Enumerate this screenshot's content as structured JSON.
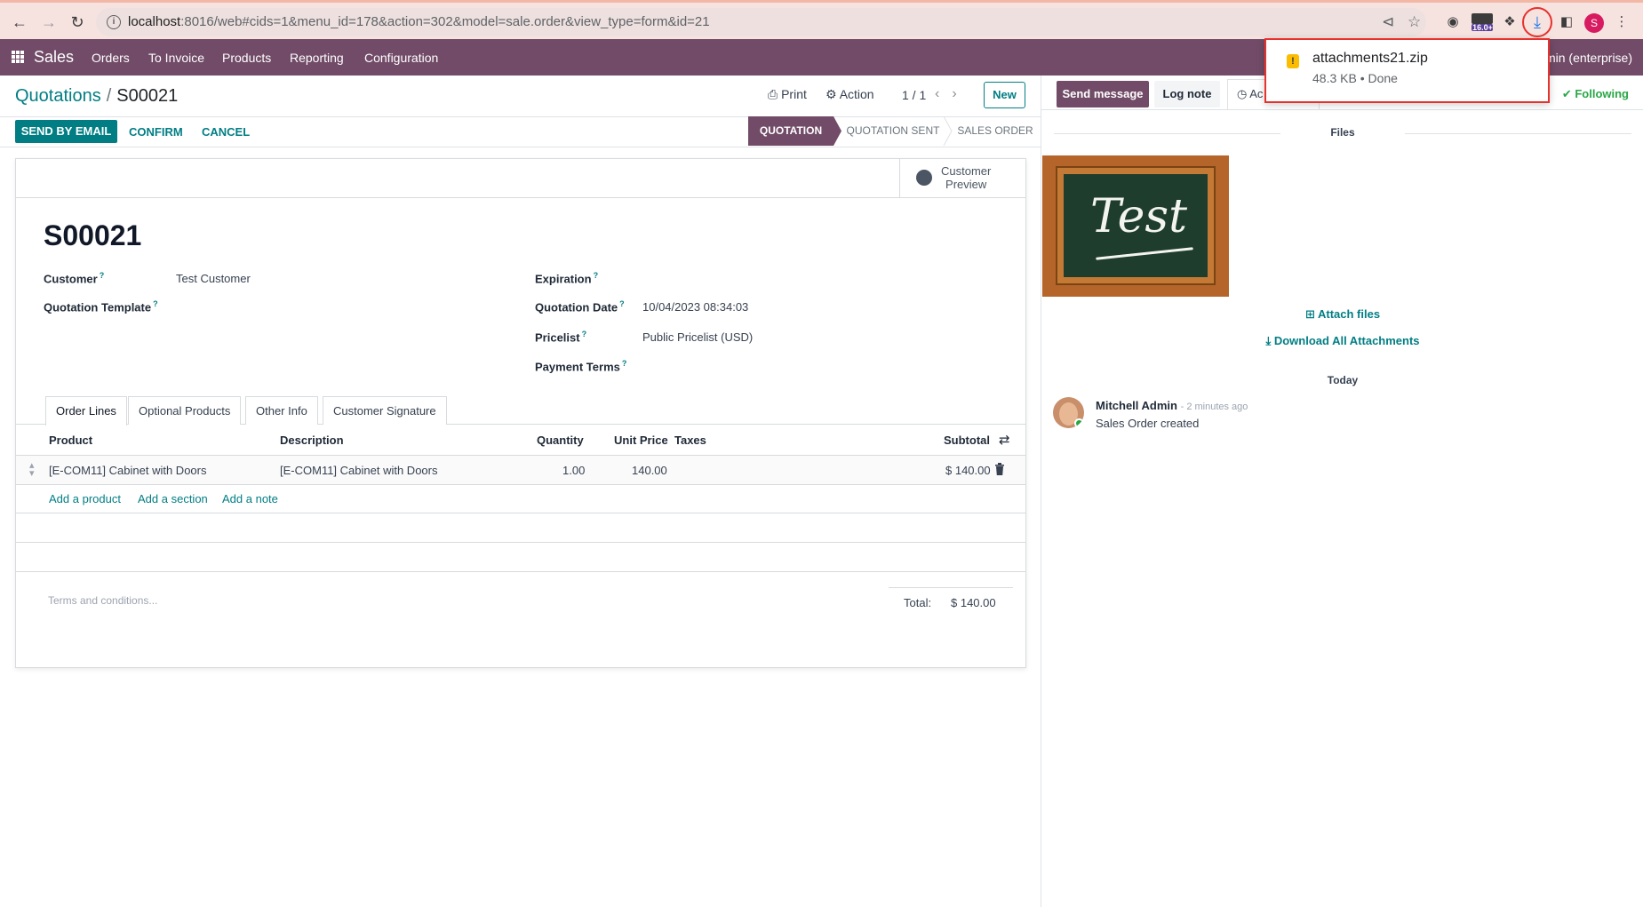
{
  "browser": {
    "url_host": "localhost",
    "url_rest": ":8016/web#cids=1&menu_id=178&action=302&model=sale.order&view_type=form&id=21",
    "ext_badge": "16.0+",
    "profile_initial": "S"
  },
  "navbar": {
    "brand": "Sales",
    "menu": [
      "Orders",
      "To Invoice",
      "Products",
      "Reporting",
      "Configuration"
    ],
    "user_partial": "min (enterprise)"
  },
  "control_panel": {
    "breadcrumb_parent": "Quotations",
    "breadcrumb_sep": "/",
    "breadcrumb_current": "S00021",
    "print": "Print",
    "action": "Action",
    "pager": "1 / 1",
    "new": "New"
  },
  "status_buttons": {
    "send_by_email": "SEND BY EMAIL",
    "confirm": "CONFIRM",
    "cancel": "CANCEL"
  },
  "stages": [
    "QUOTATION",
    "QUOTATION SENT",
    "SALES ORDER"
  ],
  "active_stage": "QUOTATION",
  "sheet": {
    "customer_preview": "Customer\nPreview",
    "order_name": "S00021",
    "fields": {
      "customer_label": "Customer",
      "customer_value": "Test Customer",
      "template_label": "Quotation Template",
      "expiration_label": "Expiration",
      "quotation_date_label": "Quotation Date",
      "quotation_date_value": "10/04/2023 08:34:03",
      "pricelist_label": "Pricelist",
      "pricelist_value": "Public Pricelist (USD)",
      "payment_terms_label": "Payment Terms"
    },
    "tooltip_mark": "?",
    "tabs": [
      "Order Lines",
      "Optional Products",
      "Other Info",
      "Customer Signature"
    ],
    "columns": {
      "product": "Product",
      "description": "Description",
      "quantity": "Quantity",
      "unit_price": "Unit Price",
      "taxes": "Taxes",
      "subtotal": "Subtotal"
    },
    "lines": [
      {
        "product": "[E-COM11] Cabinet with Doors",
        "description": "[E-COM11] Cabinet with Doors",
        "quantity": "1.00",
        "unit_price": "140.00",
        "taxes": "",
        "subtotal": "$ 140.00"
      }
    ],
    "add_links": {
      "add_product": "Add a product",
      "add_section": "Add a section",
      "add_note": "Add a note"
    },
    "terms_placeholder": "Terms and conditions...",
    "total_label": "Total:",
    "total_value": "$ 140.00"
  },
  "chatter": {
    "send_message": "Send message",
    "log_note": "Log note",
    "activities_partial": "Ac",
    "following": "Following",
    "files_title": "Files",
    "attachment_image_text": "Test",
    "attach_files": "Attach files",
    "download_all": "Download All Attachments",
    "today": "Today",
    "message": {
      "author": "Mitchell Admin",
      "time": "- 2 minutes ago",
      "body": "Sales Order created"
    }
  },
  "download_popup": {
    "filename": "attachments21.zip",
    "meta": "48.3 KB • Done"
  },
  "colors": {
    "brand": "#714b67",
    "accent": "#017e84",
    "following": "#28a745",
    "highlight": "#e8302c"
  }
}
